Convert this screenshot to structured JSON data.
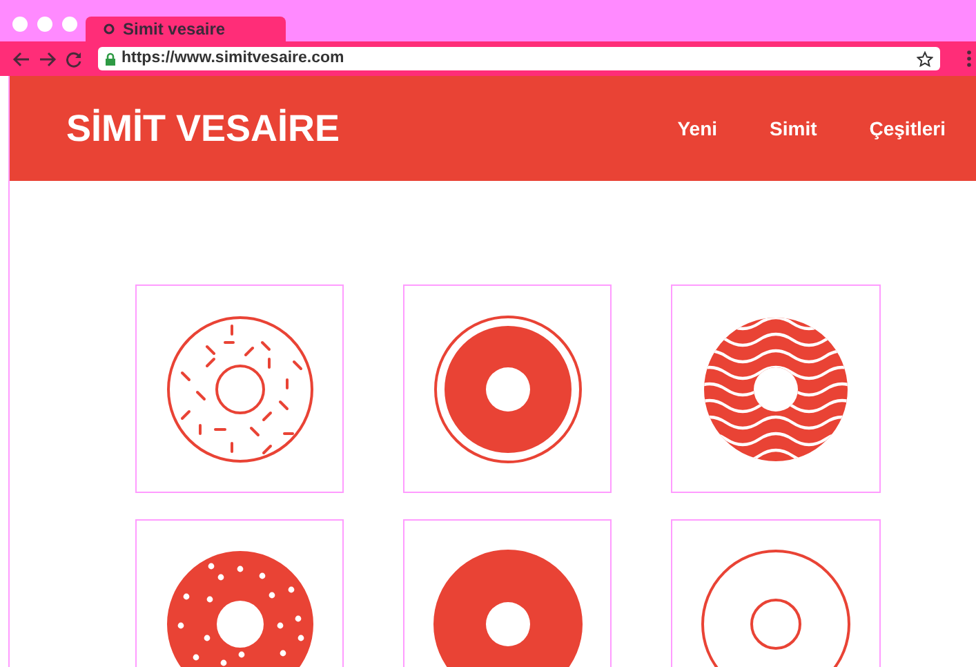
{
  "browser": {
    "tab_title": "Simit vesaire",
    "url": "https://www.simitvesaire.com"
  },
  "site": {
    "logo": "SİMİT VESAİRE",
    "nav": [
      {
        "label": "Yeni"
      },
      {
        "label": "Simit"
      },
      {
        "label": "Çeşitleri"
      }
    ]
  },
  "donuts": [
    {
      "kind": "sprinkled-outline"
    },
    {
      "kind": "ringed"
    },
    {
      "kind": "wavy"
    },
    {
      "kind": "dotted"
    },
    {
      "kind": "solid"
    },
    {
      "kind": "outline"
    }
  ]
}
